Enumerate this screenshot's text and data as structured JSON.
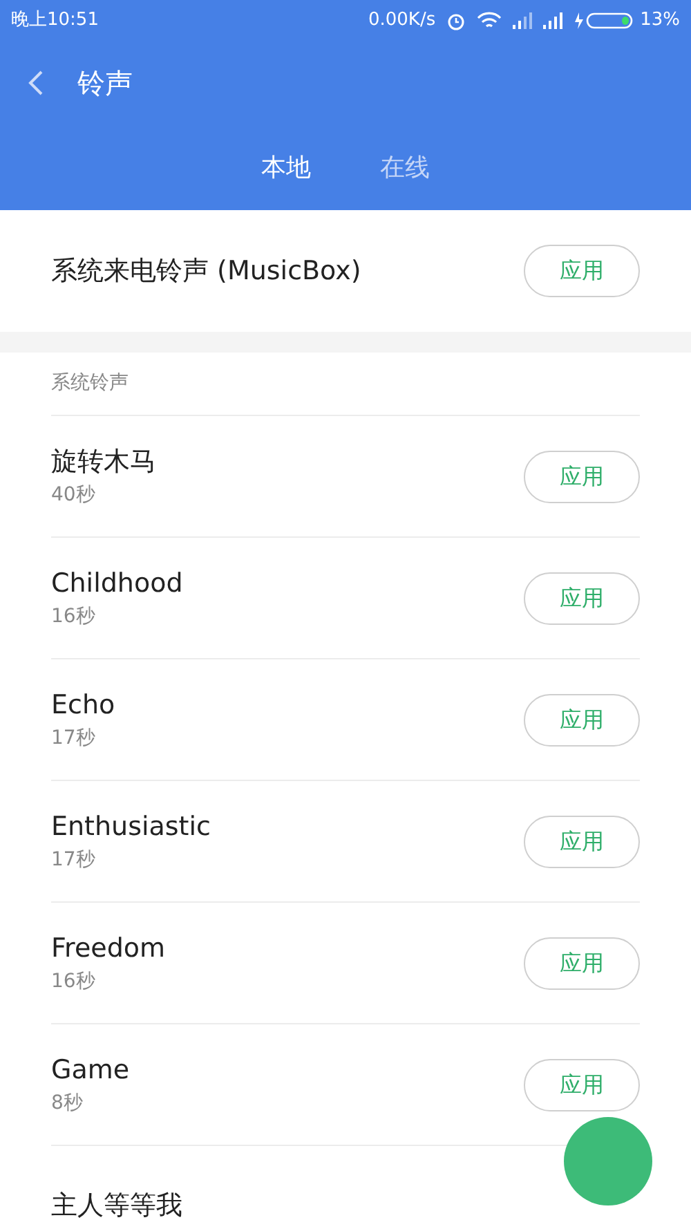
{
  "status_bar": {
    "time": "晚上10:51",
    "speed": "0.00K/s",
    "battery": "13%"
  },
  "header": {
    "title": "铃声"
  },
  "tabs": [
    {
      "label": "本地",
      "selected": true
    },
    {
      "label": "在线",
      "selected": false
    }
  ],
  "current": {
    "name": "系统来电铃声 (MusicBox)",
    "button": "应用"
  },
  "section": {
    "title": "系统铃声"
  },
  "ringtones": [
    {
      "name": "旋转木马",
      "duration": "40秒",
      "button": "应用"
    },
    {
      "name": "Childhood",
      "duration": "16秒",
      "button": "应用"
    },
    {
      "name": "Echo",
      "duration": "17秒",
      "button": "应用"
    },
    {
      "name": "Enthusiastic",
      "duration": "17秒",
      "button": "应用"
    },
    {
      "name": "Freedom",
      "duration": "16秒",
      "button": "应用"
    },
    {
      "name": "Game",
      "duration": "8秒",
      "button": "应用"
    },
    {
      "name": "主人等等我"
    }
  ]
}
